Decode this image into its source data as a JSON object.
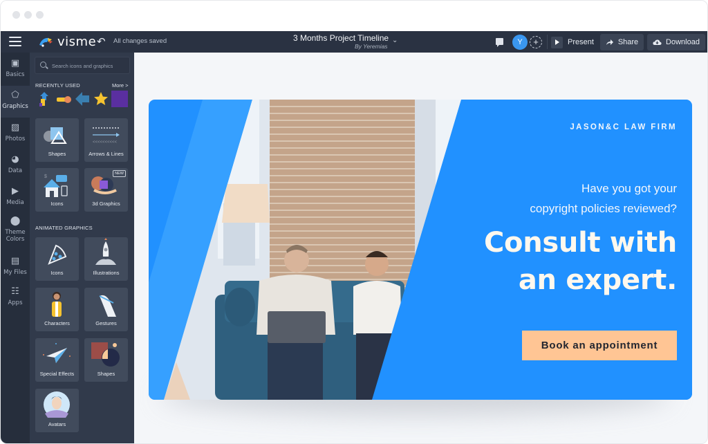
{
  "window": {
    "controls": [
      "close",
      "minimize",
      "maximize"
    ]
  },
  "topbar": {
    "menu_icon": "hamburger-icon",
    "logo_text": "visme",
    "undo_icon": "undo-icon",
    "save_status": "All changes saved",
    "doc_title": "3 Months Project Timeline",
    "doc_author": "By Yeremias",
    "comment_icon": "comment-icon",
    "user_initial": "Y",
    "add_collaborator_icon": "plus-icon",
    "present_label": "Present",
    "share_label": "Share",
    "download_label": "Download",
    "colors": {
      "bar": "#2a3242",
      "avatar": "#3a97f0"
    }
  },
  "rail": {
    "items": [
      {
        "label": "Basics",
        "icon": "basics-icon",
        "active": false
      },
      {
        "label": "Graphics",
        "icon": "graphics-icon",
        "active": true
      },
      {
        "label": "Photos",
        "icon": "photos-icon",
        "active": false
      },
      {
        "label": "Data",
        "icon": "pie-chart-icon",
        "active": false
      },
      {
        "label": "Media",
        "icon": "media-icon",
        "active": false
      },
      {
        "label": "Theme Colors",
        "label_line1": "Theme",
        "label_line2": "Colors",
        "icon": "palette-icon",
        "active": false
      },
      {
        "label": "My Files",
        "icon": "folder-upload-icon",
        "active": false
      },
      {
        "label": "Apps",
        "icon": "apps-grid-icon",
        "active": false
      }
    ]
  },
  "panel": {
    "search_placeholder": "Search icons and graphics",
    "recently_used_label": "RECENTLY USED",
    "more_label": "More >",
    "recent_items": [
      "arrows-up-icon",
      "toggle-shape-icon",
      "arrow-left-icon",
      "star-icon",
      "purple-square-icon"
    ],
    "static_tiles": [
      {
        "label": "Shapes",
        "badge": ""
      },
      {
        "label": "Arrows & Lines",
        "badge": ""
      },
      {
        "label": "Icons",
        "badge": ""
      },
      {
        "label": "3d Graphics",
        "badge": "NEW"
      }
    ],
    "animated_label": "ANIMATED GRAPHICS",
    "animated_tiles": [
      {
        "label": "Icons"
      },
      {
        "label": "Illustrations"
      },
      {
        "label": "Characters"
      },
      {
        "label": "Gestures"
      },
      {
        "label": "Special Effects"
      },
      {
        "label": "Shapes"
      },
      {
        "label": "Avatars"
      }
    ]
  },
  "slide": {
    "firm_name": "JASON&C LAW FIRM",
    "lede_line1": "Have you got your",
    "lede_line2": "copyright policies reviewed?",
    "headline_line1": "Consult with",
    "headline_line2": "an expert.",
    "cta_label": "Book an appointment",
    "photo_alt": "Two men on a blue sofa looking at a laptop in front of a brick wall",
    "colors": {
      "background": "#2191ff",
      "cta": "#ffc594",
      "headline": "#fff8ee"
    }
  }
}
